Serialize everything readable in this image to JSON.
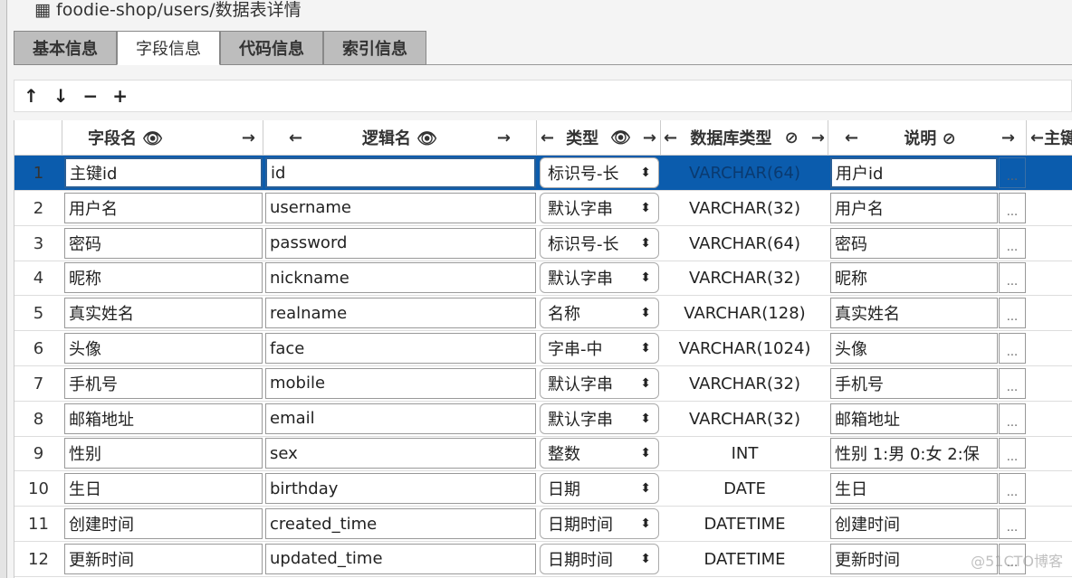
{
  "window": {
    "title": "foodie-shop/users/数据表详情",
    "icon": "table-icon"
  },
  "tabs": [
    {
      "label": "基本信息",
      "active": false
    },
    {
      "label": "字段信息",
      "active": true
    },
    {
      "label": "代码信息",
      "active": false
    },
    {
      "label": "索引信息",
      "active": false
    }
  ],
  "toolbar": {
    "up": "↑",
    "down": "↓",
    "remove": "−",
    "add": "+"
  },
  "columns": {
    "field": "字段名",
    "logical": "逻辑名",
    "type": "类型",
    "dbtype": "数据库类型",
    "desc": "说明",
    "pk": "主键",
    "left_arrow": "←",
    "right_arrow": "→",
    "eye": "👁",
    "eye_off": "⊘"
  },
  "rows": [
    {
      "n": "1",
      "field": "主键id",
      "logical": "id",
      "type": "标识号-长",
      "dbtype": "VARCHAR(64)",
      "desc": "用户id",
      "selected": true
    },
    {
      "n": "2",
      "field": "用户名",
      "logical": "username",
      "type": "默认字串",
      "dbtype": "VARCHAR(32)",
      "desc": "用户名"
    },
    {
      "n": "3",
      "field": "密码",
      "logical": "password",
      "type": "标识号-长",
      "dbtype": "VARCHAR(64)",
      "desc": "密码"
    },
    {
      "n": "4",
      "field": "昵称",
      "logical": "nickname",
      "type": "默认字串",
      "dbtype": "VARCHAR(32)",
      "desc": "昵称"
    },
    {
      "n": "5",
      "field": "真实姓名",
      "logical": "realname",
      "type": "名称",
      "dbtype": "VARCHAR(128)",
      "desc": "真实姓名"
    },
    {
      "n": "6",
      "field": "头像",
      "logical": "face",
      "type": "字串-中",
      "dbtype": "VARCHAR(1024)",
      "desc": "头像"
    },
    {
      "n": "7",
      "field": "手机号",
      "logical": "mobile",
      "type": "默认字串",
      "dbtype": "VARCHAR(32)",
      "desc": "手机号"
    },
    {
      "n": "8",
      "field": "邮箱地址",
      "logical": "email",
      "type": "默认字串",
      "dbtype": "VARCHAR(32)",
      "desc": "邮箱地址"
    },
    {
      "n": "9",
      "field": "性别",
      "logical": "sex",
      "type": "整数",
      "dbtype": "INT",
      "desc": "性别 1:男  0:女  2:保"
    },
    {
      "n": "10",
      "field": "生日",
      "logical": "birthday",
      "type": "日期",
      "dbtype": "DATE",
      "desc": "生日"
    },
    {
      "n": "11",
      "field": "创建时间",
      "logical": "created_time",
      "type": "日期时间",
      "dbtype": "DATETIME",
      "desc": "创建时间"
    },
    {
      "n": "12",
      "field": "更新时间",
      "logical": "updated_time",
      "type": "日期时间",
      "dbtype": "DATETIME",
      "desc": "更新时间"
    }
  ],
  "more_label": "...",
  "select_arrow": "⬍",
  "watermark": "@51CTO博客",
  "colors": {
    "selected_row": "#0b5cad"
  }
}
